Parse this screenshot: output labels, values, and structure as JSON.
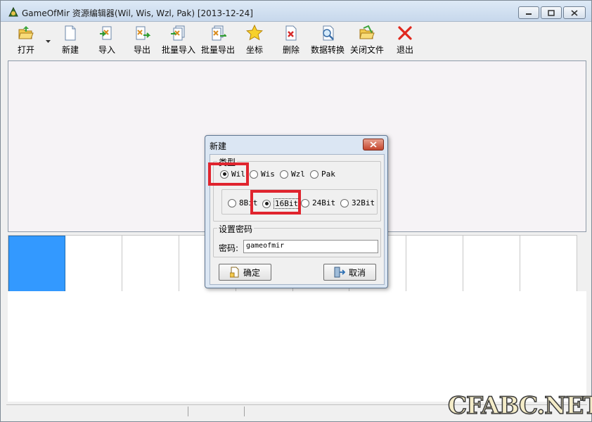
{
  "window": {
    "title": "GameOfMir 资源编辑器(Wil, Wis, Wzl, Pak) [2013-12-24]",
    "icon": "app-icon"
  },
  "toolbar": {
    "items": [
      {
        "label": "打开",
        "icon": "open-folder-icon"
      },
      {
        "label": "新建",
        "icon": "new-file-icon"
      },
      {
        "label": "导入",
        "icon": "import-icon"
      },
      {
        "label": "导出",
        "icon": "export-icon"
      },
      {
        "label": "批量导入",
        "icon": "batch-import-icon"
      },
      {
        "label": "批量导出",
        "icon": "batch-export-icon"
      },
      {
        "label": "坐标",
        "icon": "star-icon"
      },
      {
        "label": "删除",
        "icon": "delete-icon"
      },
      {
        "label": "数据转换",
        "icon": "convert-icon"
      },
      {
        "label": "关闭文件",
        "icon": "close-file-icon"
      },
      {
        "label": "退出",
        "icon": "exit-icon"
      }
    ]
  },
  "dialog": {
    "title": "新建",
    "type_group": {
      "label": "类型",
      "options": [
        "Wil",
        "Wis",
        "Wzl",
        "Pak"
      ],
      "selected": "Wil"
    },
    "bit_group": {
      "options": [
        "8Bit",
        "16Bit",
        "24Bit",
        "32Bit"
      ],
      "selected": "16Bit"
    },
    "password_group": {
      "label": "设置密码",
      "field_label": "密码:",
      "value": "gameofmir"
    },
    "ok_label": "确定",
    "cancel_label": "取消"
  },
  "watermark": "CFABC.NET",
  "colors": {
    "selection": "#3399ff",
    "highlight": "#e0242e"
  }
}
